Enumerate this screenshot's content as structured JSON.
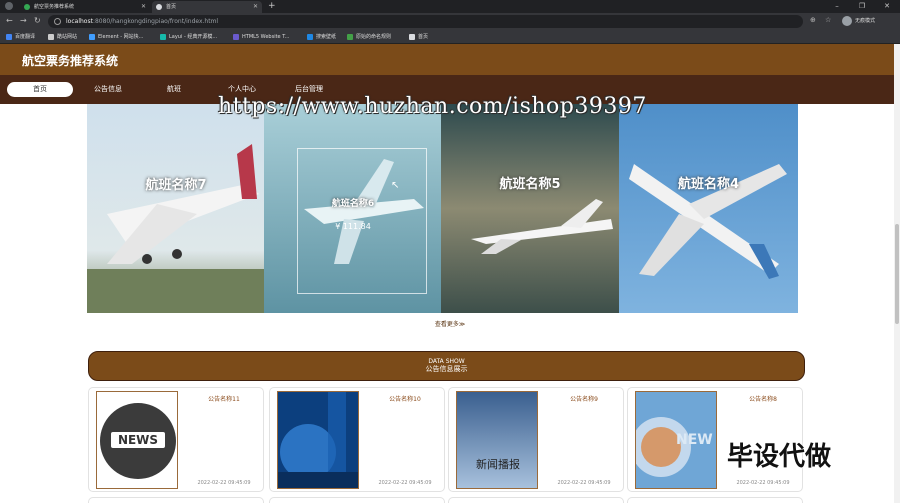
{
  "browser": {
    "tabs": [
      {
        "label": "航空票务推荐系统",
        "favicon_color": "#34a853"
      },
      {
        "label": "首页",
        "favicon_color": "#dadce0"
      }
    ],
    "url_host": "localhost",
    "url_path": ":8080/hangkongdingpiao/front/index.html",
    "profile_label": "无痕模式",
    "bookmarks": [
      {
        "label": "百度翻译",
        "color": "#4285f4"
      },
      {
        "label": "酷站网站",
        "color": "#333"
      },
      {
        "label": "Element - 网站快...",
        "color": "#409eff"
      },
      {
        "label": "Layui - 经典开源模...",
        "color": "#16baaa"
      },
      {
        "label": "HTML5 Website T...",
        "color": "#6a5acd"
      },
      {
        "label": "搜索壁纸",
        "color": "#1e88e5"
      },
      {
        "label": "原始的命名规则",
        "color": "#43a047"
      },
      {
        "label": "首页",
        "color": "#dadce0"
      }
    ]
  },
  "site": {
    "title": "航空票务推荐系统",
    "nav": [
      "首页",
      "公告信息",
      "航班",
      "个人中心",
      "后台管理"
    ]
  },
  "watermark": "https://www.huzhan.com/ishop39397",
  "carousel": {
    "slides": [
      {
        "title": "航班名称7",
        "price": ""
      },
      {
        "title": "航班名称6",
        "price": "¥ 111.84"
      },
      {
        "title": "航班名称5",
        "price": ""
      },
      {
        "title": "航班名称4",
        "price": ""
      }
    ],
    "more_label": "查看更多≫"
  },
  "notices": {
    "subtitle": "DATA SHOW",
    "title": "公告信息展示",
    "items": [
      {
        "name": "公告名称11",
        "date": "2022-02-22 09:45:09",
        "image_caption": "NEWS"
      },
      {
        "name": "公告名称10",
        "date": "2022-02-22 09:45:09",
        "image_caption": ""
      },
      {
        "name": "公告名称9",
        "date": "2022-02-22 09:45:09",
        "image_caption": "新闻播报"
      },
      {
        "name": "公告名称8",
        "date": "2022-02-22 09:45:09",
        "image_caption": "NEW"
      }
    ]
  },
  "overlay_stamp": "毕设代做"
}
